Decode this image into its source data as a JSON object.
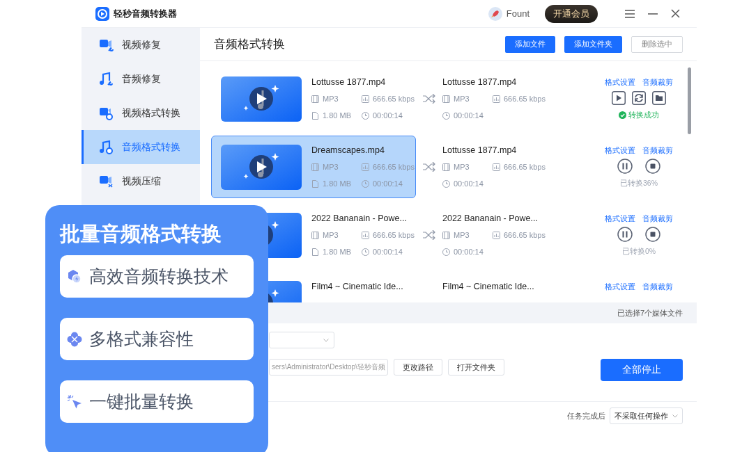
{
  "app": {
    "title": "轻秒音频转换器",
    "user": "Fount",
    "vip_button": "开通会员"
  },
  "sidebar": {
    "items": [
      {
        "kind": "video-repair",
        "label": "视频修复",
        "selected": false
      },
      {
        "kind": "audio-repair",
        "label": "音频修复",
        "selected": false
      },
      {
        "kind": "video-convert",
        "label": "视频格式转换",
        "selected": false
      },
      {
        "kind": "audio-convert",
        "label": "音频格式转换",
        "selected": true
      },
      {
        "kind": "video-compress",
        "label": "视频压缩",
        "selected": false
      }
    ]
  },
  "page": {
    "title": "音频格式转换",
    "buttons": [
      {
        "kind": "primary",
        "label": "添加文件"
      },
      {
        "kind": "primary",
        "label": "添加文件夹"
      },
      {
        "kind": "outline",
        "label": "删除选中"
      }
    ]
  },
  "files": [
    {
      "selected": false,
      "name": "Lottusse 1877.mp4",
      "format": "MP3",
      "bitrate": "666.65 kbps",
      "size": "1.80 MB",
      "duration": "00:00:14",
      "target": {
        "name": "Lottusse 1877.mp4",
        "format": "MP3",
        "bitrate": "666.65 kbps",
        "duration": "00:00:14"
      },
      "links": [
        "格式设置",
        "音频裁剪"
      ],
      "kind": "done",
      "status": "转换成功"
    },
    {
      "selected": true,
      "name": "Dreamscapes.mp4",
      "format": "MP3",
      "bitrate": "666.65 kbps",
      "size": "1.80 MB",
      "duration": "00:00:14",
      "target": {
        "name": "Lottusse 1877.mp4",
        "format": "MP3",
        "bitrate": "666.65 kbps",
        "duration": "00:00:14"
      },
      "links": [
        "格式设置",
        "音频裁剪"
      ],
      "kind": "converting",
      "status": "已转换36%"
    },
    {
      "selected": false,
      "name": "2022 Bananain - Powe...",
      "format": "MP3",
      "bitrate": "666.65 kbps",
      "size": "1.80 MB",
      "duration": "00:00:14",
      "target": {
        "name": "2022 Bananain - Powe...",
        "format": "MP3",
        "bitrate": "666.65 kbps",
        "duration": "00:00:14"
      },
      "links": [
        "格式设置",
        "音频裁剪"
      ],
      "kind": "converting",
      "status": "已转换0%"
    },
    {
      "selected": false,
      "name": "Film4 ~ Cinematic Ide...",
      "target": {
        "name": "Film4 ~ Cinematic Ide..."
      },
      "links": [
        "格式设置",
        "音频裁剪"
      ]
    }
  ],
  "selection_summary": "已选择7个媒体文件",
  "output": {
    "path": "sers\\Administrator\\Desktop\\轻秒音频",
    "path_buttons": [
      "更改路径",
      "打开文件夹"
    ],
    "stop_all": "全部停止",
    "after_label": "任务完成后",
    "after_value": "不采取任何操作"
  },
  "promo": {
    "title": "批量音频格式转换",
    "features": [
      {
        "kind": "engine",
        "label": "高效音频转换技术"
      },
      {
        "kind": "formats",
        "label": "多格式兼容性"
      },
      {
        "kind": "click",
        "label": "一键批量转换"
      }
    ]
  }
}
